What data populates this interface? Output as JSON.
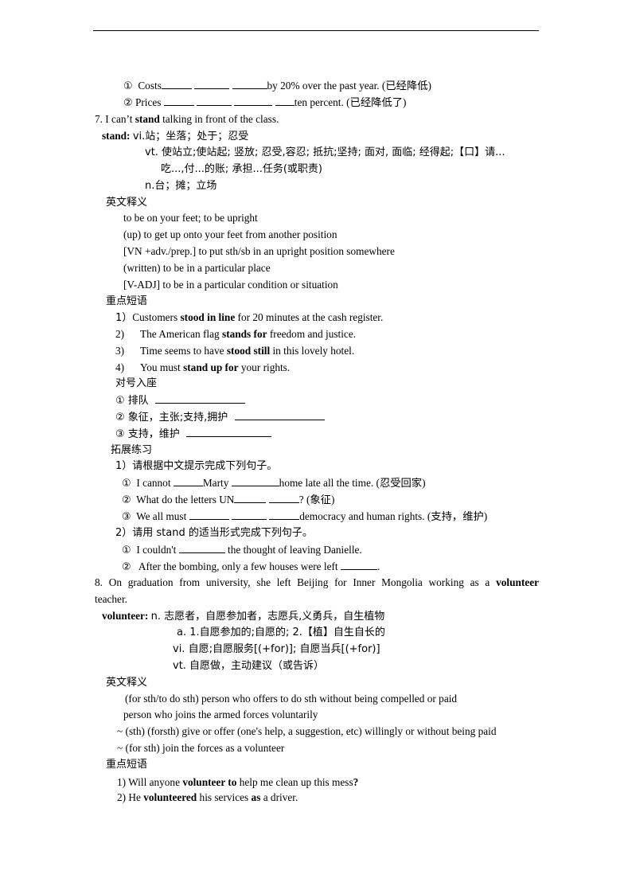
{
  "header_rule": true,
  "item6_exercises": [
    {
      "marker": "①",
      "before": "Costs",
      "blanks": 3,
      "after": "by 20% over the past year. (已经降低)"
    },
    {
      "marker": "②",
      "before": "Prices",
      "blanks": 4,
      "after": "ten percent. (已经降低了)"
    }
  ],
  "item7": {
    "sentence_pre": "7. I can’t ",
    "sentence_bold": "stand",
    "sentence_post": " talking in front of the class.",
    "headword": "stand:",
    "vi": "vi.站；坐落；处于；忍受",
    "vt_line1": "vt. 使站立;使站起; 竖放; 忍受,容忍; 抵抗;坚持; 面对, 面临; 经得起;【口】请...",
    "vt_line2": "吃...,付...的账; 承担...任务(或职责)",
    "n": "n.台；摊；立场",
    "en_def_heading": "英文释义",
    "en_defs": [
      "to be on your feet; to be upright",
      "(up) to get up onto your feet from another position",
      "[VN +adv./prep.] to put sth/sb in an upright position somewhere",
      "(written) to be in a particular place",
      "[V-ADJ] to be in a particular condition or situation"
    ],
    "phrases_heading": "重点短语",
    "phrases": [
      {
        "num": "1）",
        "pre": "Customers ",
        "bold": "stood in line",
        "post": " for 20 minutes at the cash register."
      },
      {
        "num": "2)",
        "pre": "The American flag ",
        "bold": "stands for",
        "post": " freedom and justice."
      },
      {
        "num": "3)",
        "pre": "Time seems to have ",
        "bold": "stood still",
        "post": " in this lovely hotel."
      },
      {
        "num": "4)",
        "pre": "You must ",
        "bold": "stand up for",
        "post": " your rights."
      }
    ],
    "match_heading": "对号入座",
    "match": [
      {
        "marker": "①",
        "text": "排队"
      },
      {
        "marker": "②",
        "text": "象征，主张;支持,拥护"
      },
      {
        "marker": "③",
        "text": "支持，维护"
      }
    ],
    "practice_heading": "拓展练习",
    "practice1_title": "1）请根据中文提示完成下列句子。",
    "practice1": [
      {
        "marker": "①",
        "a": "I cannot ",
        "b": "Marty ",
        "c": "home late all the time. (忍受回家)"
      },
      {
        "marker": "②",
        "a": "What do the letters UN",
        "b": "",
        "c": "? (象征)"
      },
      {
        "marker": "③",
        "a": "We all must ",
        "b": "",
        "c": "democracy and human rights. (支持，维护)"
      }
    ],
    "practice2_title": "2）请用 stand 的适当形式完成下列句子。",
    "practice2": [
      {
        "marker": "①",
        "a": "I couldn't ",
        "c": " the thought of leaving Danielle."
      },
      {
        "marker": "②",
        "a": "After the bombing, only a few houses were left ",
        "c": "."
      }
    ]
  },
  "item8": {
    "sentence_line1_pre": "8. On graduation from university, she left Beijing for Inner Mongolia working as a ",
    "sentence_line1_bold": "volunteer",
    "sentence_line2": "teacher.",
    "headword": "volunteer:",
    "n": "n.  志愿者，自愿参加者，志愿兵,义勇兵，自生植物",
    "a": "a. 1.自愿参加的;自愿的;   2.【植】自生自长的",
    "vi": "vi.  自愿;自愿服务[(+for)]; 自愿当兵[(+for)]",
    "vt": "vt.  自愿做，主动建议（或告诉）",
    "en_def_heading": "英文释义",
    "en_defs": [
      "(for sth/to do sth) person who offers to do sth without being compelled or paid",
      "person who joins the armed forces voluntarily",
      "~ (sth) (forsth) give or offer (one's help, a suggestion, etc) willingly or without being paid",
      "~ (for sth) join the forces as a volunteer"
    ],
    "phrases_heading": "重点短语",
    "phrases": [
      {
        "pre": "1) Will anyone ",
        "bold": "volunteer to",
        "post": " help me clean up this mess",
        "end": "?"
      },
      {
        "pre": "2) He ",
        "bold": "volunteered",
        "post": " his services ",
        "bold2": "as",
        "post2": " a driver."
      }
    ]
  }
}
